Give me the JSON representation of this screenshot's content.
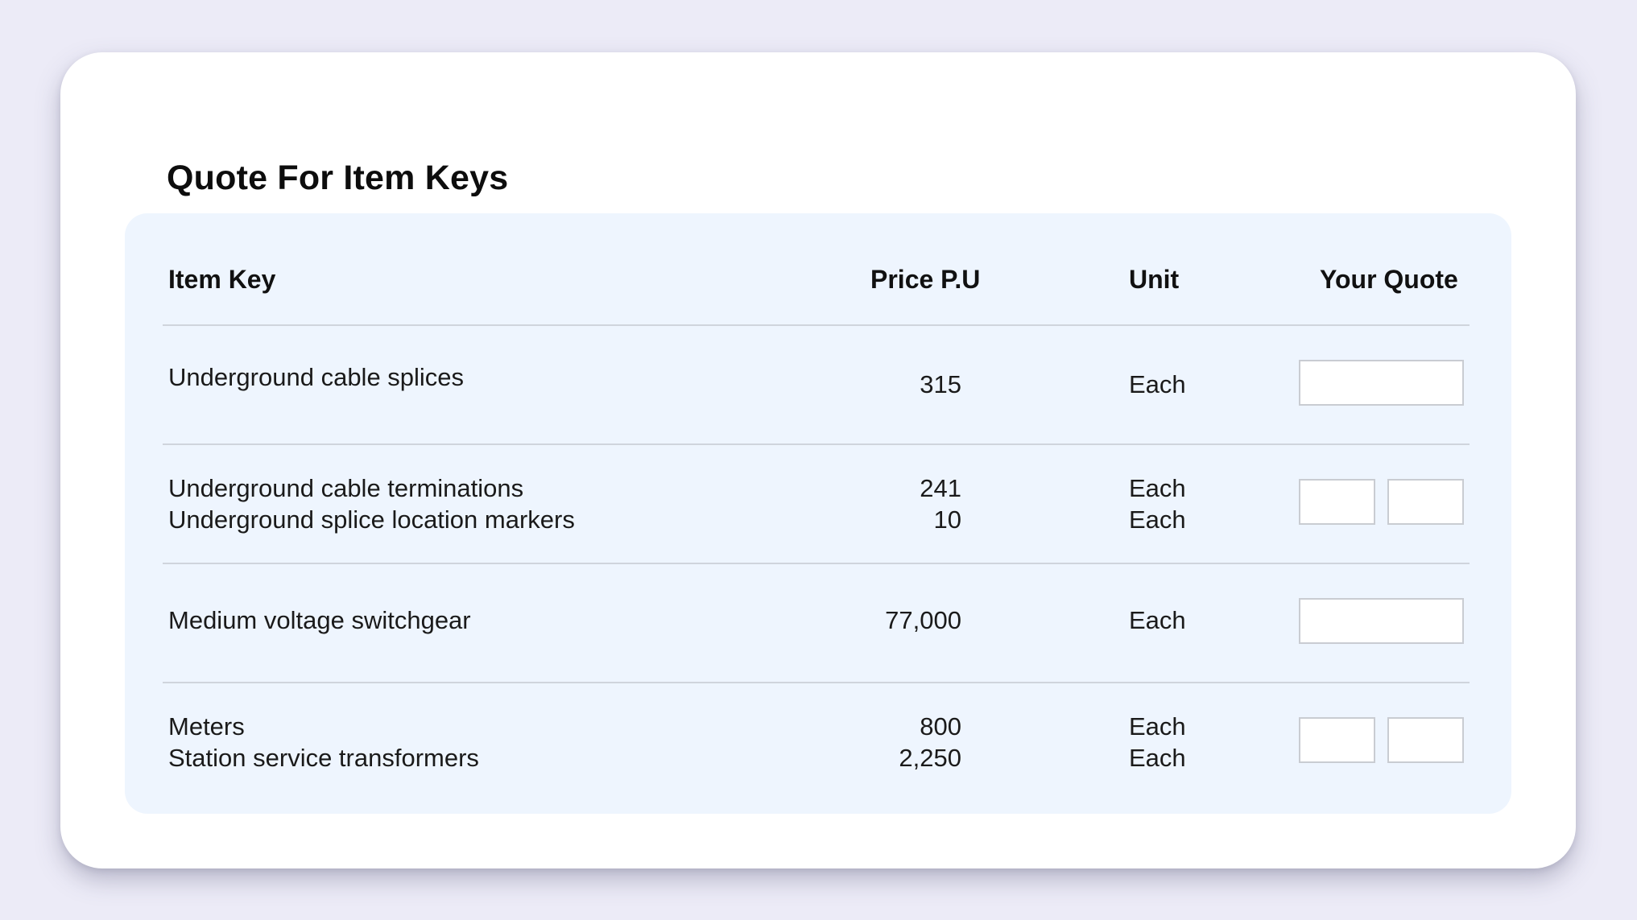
{
  "title": "Quote For Item Keys",
  "table": {
    "headers": {
      "item_key": "Item Key",
      "price": "Price P.U",
      "unit": "Unit",
      "quote": "Your Quote"
    },
    "rows": [
      {
        "items": [
          "Underground cable splices"
        ],
        "prices": [
          "315"
        ],
        "units": [
          "Each"
        ],
        "quote_inputs": [
          ""
        ]
      },
      {
        "items": [
          "Underground cable terminations",
          "Underground splice location markers"
        ],
        "prices": [
          "241",
          "10"
        ],
        "units": [
          "Each",
          "Each"
        ],
        "quote_inputs": [
          "",
          ""
        ]
      },
      {
        "items": [
          "Medium voltage switchgear"
        ],
        "prices": [
          "77,000"
        ],
        "units": [
          "Each"
        ],
        "quote_inputs": [
          ""
        ]
      },
      {
        "items": [
          "Meters",
          "Station service transformers"
        ],
        "prices": [
          "800",
          "2,250"
        ],
        "units": [
          "Each",
          "Each"
        ],
        "quote_inputs": [
          "",
          ""
        ]
      }
    ]
  },
  "colors": {
    "page_background": "#ecebf7",
    "card_background": "#ffffff",
    "panel_background": "#eef5fe",
    "divider": "#cfd4dc",
    "input_border": "#c9ccd2"
  }
}
